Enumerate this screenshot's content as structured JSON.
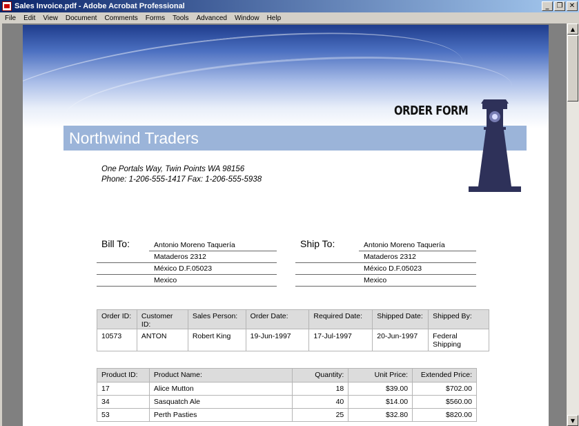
{
  "window": {
    "title": "Sales Invoice.pdf - Adobe Acrobat Professional",
    "minimize": "_",
    "restore": "❐",
    "close": "✕"
  },
  "menu": [
    "File",
    "Edit",
    "View",
    "Document",
    "Comments",
    "Forms",
    "Tools",
    "Advanced",
    "Window",
    "Help"
  ],
  "document": {
    "order_form_label": "ORDER FORM",
    "company": "Northwind Traders",
    "address_line": "One Portals Way, Twin Points WA 98156",
    "phone_line": "Phone: 1-206-555-1417 Fax: 1-206-555-5938",
    "bill_to": {
      "label": "Bill To:",
      "lines": [
        "Antonio Moreno Taquería",
        "Mataderos  2312",
        "México D.F.05023",
        "Mexico"
      ]
    },
    "ship_to": {
      "label": "Ship To:",
      "lines": [
        "Antonio Moreno Taquería",
        "Mataderos  2312",
        "México D.F.05023",
        "Mexico"
      ]
    },
    "order_table": {
      "headers": [
        "Order ID:",
        "Customer ID:",
        "Sales Person:",
        "Order Date:",
        "Required Date:",
        "Shipped Date:",
        "Shipped By:"
      ],
      "row": [
        "10573",
        "ANTON",
        "Robert King",
        "19-Jun-1997",
        "17-Jul-1997",
        "20-Jun-1997",
        "Federal Shipping"
      ]
    },
    "product_table": {
      "headers": [
        "Product ID:",
        "Product Name:",
        "Quantity:",
        "Unit Price:",
        "Extended Price:"
      ],
      "rows": [
        [
          "17",
          "Alice Mutton",
          "18",
          "$39.00",
          "$702.00"
        ],
        [
          "34",
          "Sasquatch Ale",
          "40",
          "$14.00",
          "$560.00"
        ],
        [
          "53",
          "Perth Pasties",
          "25",
          "$32.80",
          "$820.00"
        ]
      ]
    }
  },
  "scrollbar": {
    "up": "▲",
    "down": "▼"
  },
  "colors": {
    "banner": "#9bb4d9",
    "titlebar": "#0a246a",
    "lighthouse": "#2e3159"
  }
}
